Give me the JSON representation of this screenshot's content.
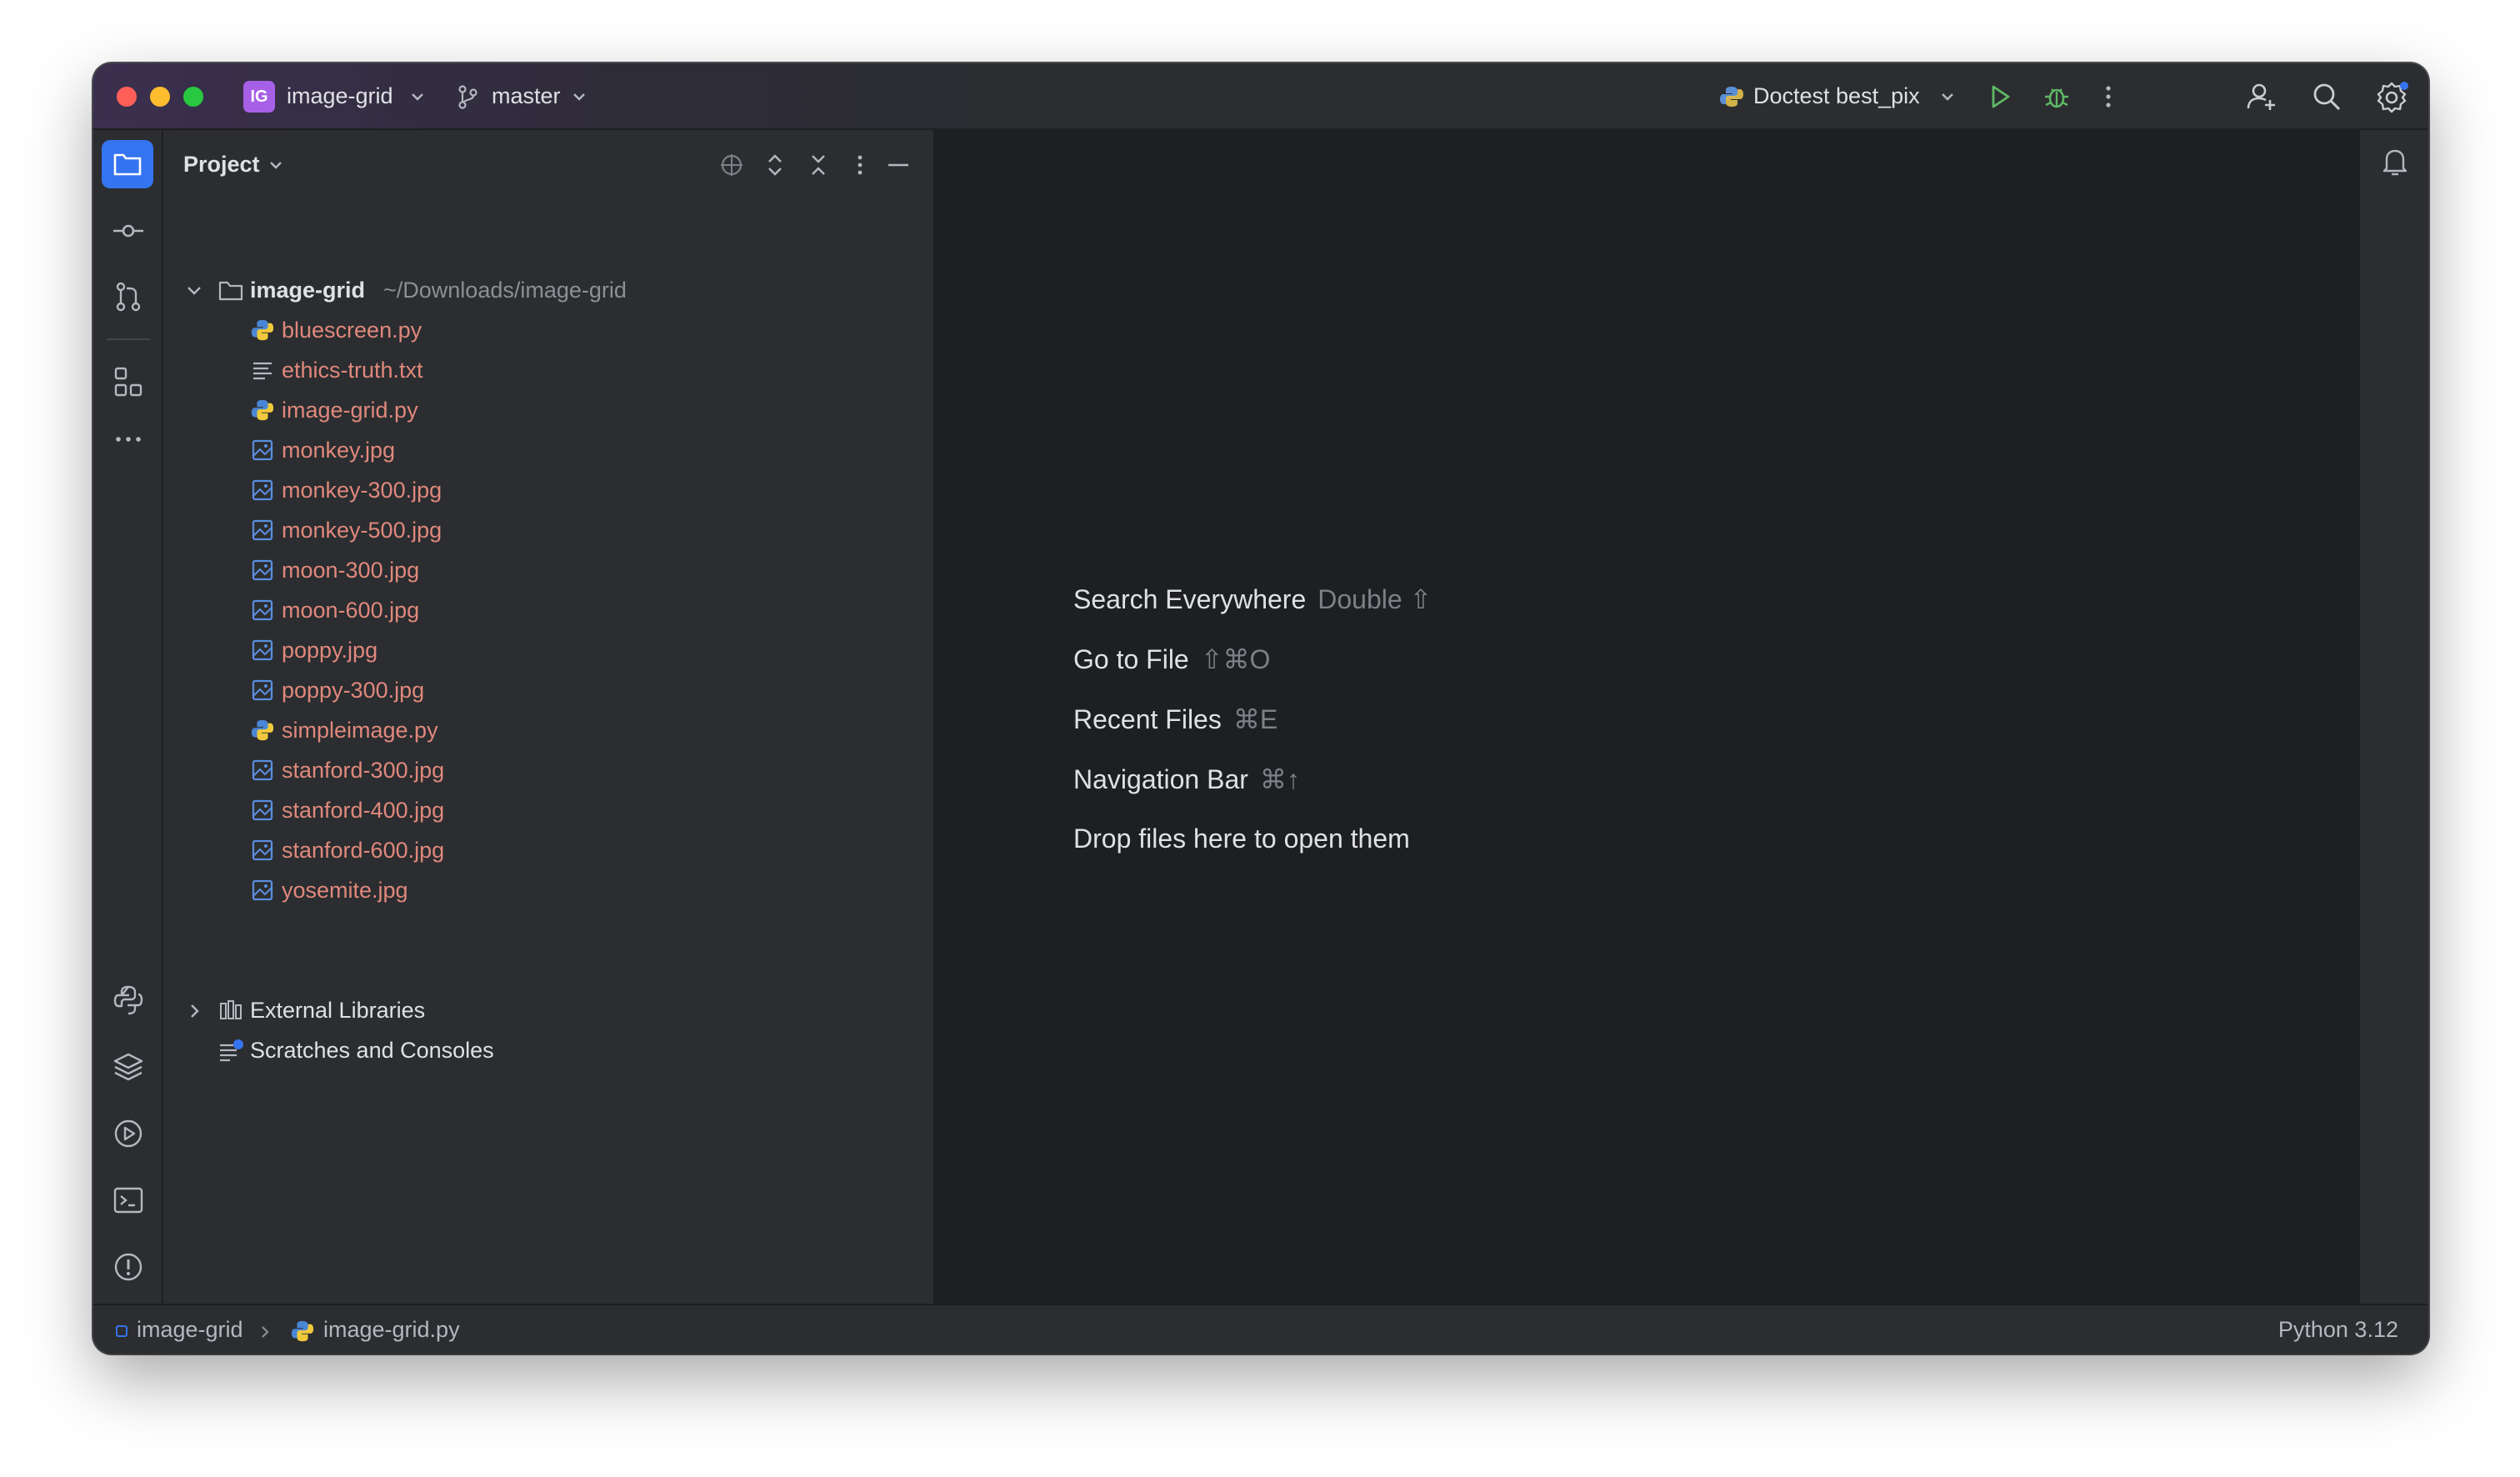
{
  "titlebar": {
    "project_badge": "IG",
    "project_name": "image-grid",
    "branch": "master",
    "run_config": "Doctest best_pix",
    "icons": [
      "run-icon",
      "debug-icon",
      "more-icon",
      "add-user-icon",
      "search-icon",
      "settings-icon"
    ]
  },
  "left_strip": {
    "icons": [
      "project-folder-icon",
      "commit-icon",
      "pull-request-icon",
      "structure-icon",
      "more-tools-icon",
      "python-console-icon",
      "layers-icon",
      "services-icon",
      "terminal-icon",
      "problems-icon",
      "git-icon"
    ]
  },
  "project_panel": {
    "title": "Project",
    "root": {
      "name": "image-grid",
      "path": "~/Downloads/image-grid"
    },
    "files": [
      {
        "name": "bluescreen.py",
        "type": "python"
      },
      {
        "name": "ethics-truth.txt",
        "type": "text"
      },
      {
        "name": "image-grid.py",
        "type": "python"
      },
      {
        "name": "monkey.jpg",
        "type": "image"
      },
      {
        "name": "monkey-300.jpg",
        "type": "image"
      },
      {
        "name": "monkey-500.jpg",
        "type": "image"
      },
      {
        "name": "moon-300.jpg",
        "type": "image"
      },
      {
        "name": "moon-600.jpg",
        "type": "image"
      },
      {
        "name": "poppy.jpg",
        "type": "image"
      },
      {
        "name": "poppy-300.jpg",
        "type": "image"
      },
      {
        "name": "simpleimage.py",
        "type": "python"
      },
      {
        "name": "stanford-300.jpg",
        "type": "image"
      },
      {
        "name": "stanford-400.jpg",
        "type": "image"
      },
      {
        "name": "stanford-600.jpg",
        "type": "image"
      },
      {
        "name": "yosemite.jpg",
        "type": "image"
      }
    ],
    "external_libraries": "External Libraries",
    "scratches": "Scratches and Consoles"
  },
  "editor_hints": [
    {
      "label": "Search Everywhere",
      "key": "Double ⇧"
    },
    {
      "label": "Go to File",
      "key": "⇧⌘O"
    },
    {
      "label": "Recent Files",
      "key": "⌘E"
    },
    {
      "label": "Navigation Bar",
      "key": "⌘↑"
    },
    {
      "label": "Drop files here to open them",
      "key": ""
    }
  ],
  "statusbar": {
    "breadcrumb_project": "image-grid",
    "breadcrumb_file": "image-grid.py",
    "interpreter": "Python 3.12"
  },
  "colors": {
    "accent": "#3574f0",
    "file_modified": "#e0887c",
    "badge": "#a660e8"
  }
}
